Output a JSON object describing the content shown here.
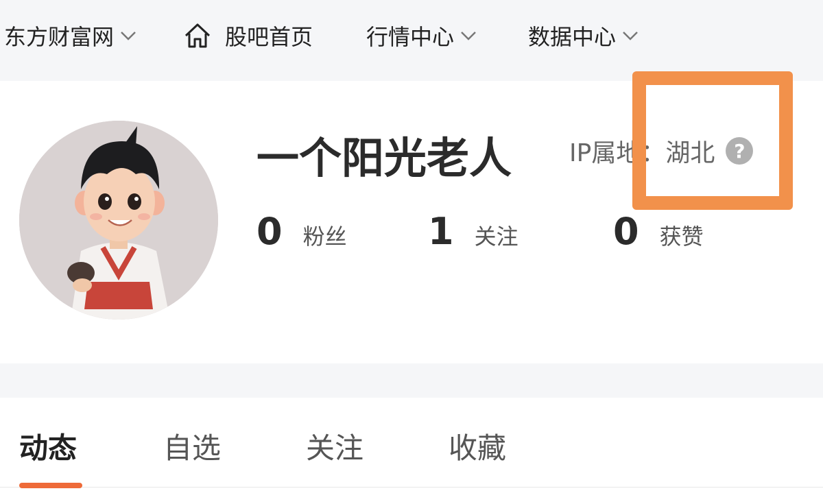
{
  "topnav": {
    "items": [
      {
        "label": "东方财富网",
        "has_dropdown": true
      },
      {
        "label": "股吧首页",
        "icon": "home-icon",
        "has_dropdown": false
      },
      {
        "label": "行情中心",
        "has_dropdown": true
      },
      {
        "label": "数据中心",
        "has_dropdown": true
      }
    ]
  },
  "profile": {
    "username": "一个阳光老人",
    "ip_label": "IP属地：",
    "ip_value": "湖北",
    "help_icon": "question-circle-icon",
    "stats": [
      {
        "value": "0",
        "label": "粉丝"
      },
      {
        "value": "1",
        "label": "关注"
      },
      {
        "value": "0",
        "label": "获赞"
      }
    ]
  },
  "tabs": {
    "items": [
      {
        "label": "动态",
        "active": true
      },
      {
        "label": "自选",
        "active": false
      },
      {
        "label": "关注",
        "active": false
      },
      {
        "label": "收藏",
        "active": false
      }
    ]
  },
  "colors": {
    "accent": "#ee6a38",
    "highlight_box": "#f2914b",
    "nav_bg": "#f5f6f8"
  }
}
